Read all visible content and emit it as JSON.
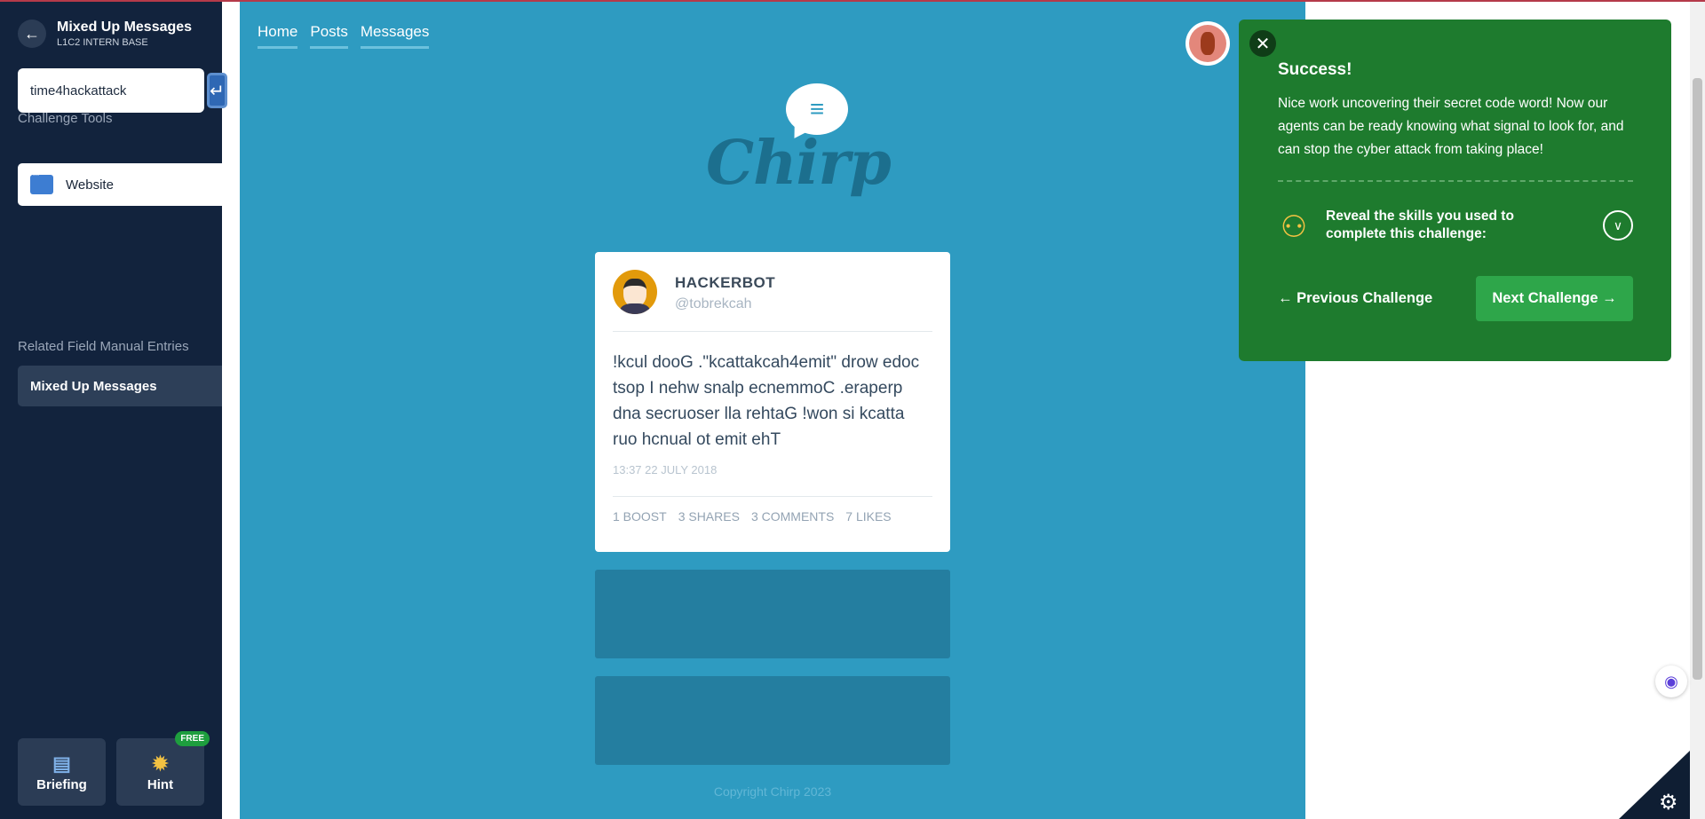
{
  "sidebar": {
    "back_icon": "arrow-left-icon",
    "title": "Mixed Up Messages",
    "subtitle": "L1C2 INTERN BASE",
    "flag_input_value": "time4hackattack",
    "submit_icon": "enter-icon",
    "tools_heading": "Challenge Tools",
    "tool_label": "Website",
    "manual_heading": "Related Field Manual Entries",
    "manual_item": "Mixed Up Messages",
    "briefing_label": "Briefing",
    "hint_label": "Hint",
    "hint_badge": "FREE"
  },
  "site": {
    "nav": [
      "Home",
      "Posts",
      "Messages"
    ],
    "logo_text": "Chirp",
    "post": {
      "name": "HACKERBOT",
      "handle": "@tobrekcah",
      "body": "!kcul dooG .\"kcattakcah4emit\" drow edoc tsop I nehw snalp ecnemmoC .eraperp dna secruoser lla rehtaG !won si kcatta ruo hcnual ot emit ehT",
      "time": "13:37 22 JULY 2018",
      "stats": [
        "1 BOOST",
        "3 SHARES",
        "3 COMMENTS",
        "7 LIKES"
      ]
    },
    "copyright": "Copyright Chirp 2023"
  },
  "success": {
    "close_icon": "close-icon",
    "title": "Success!",
    "message": "Nice work uncovering their secret code word! Now our agents can be ready knowing what signal to look for, and can stop the cyber attack from taking place!",
    "skills_text": "Reveal the skills you used to complete this challenge:",
    "prev_label": "← Previous Challenge",
    "next_label": "Next Challenge →"
  },
  "colors": {
    "sidebar_bg": "#12233d",
    "site_bg": "#2e9bc1",
    "success_bg": "#1e7b2e",
    "next_btn": "#2ea64a"
  }
}
